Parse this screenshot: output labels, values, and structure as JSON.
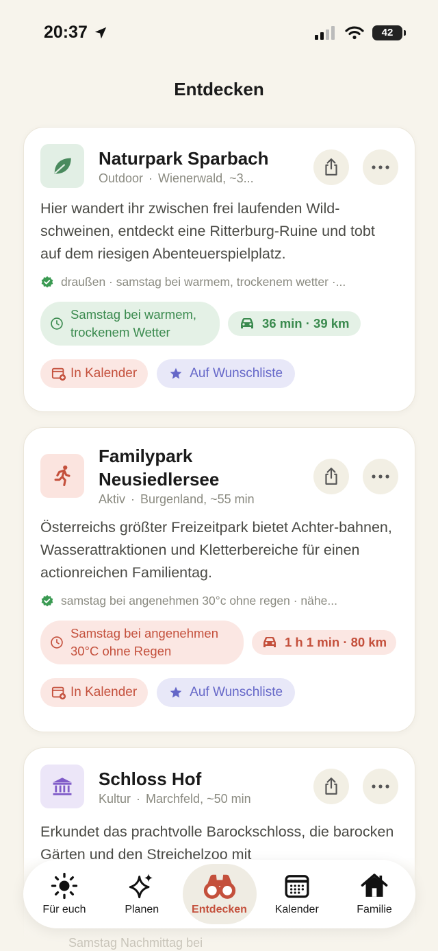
{
  "status": {
    "time": "20:37",
    "battery": "42"
  },
  "page": {
    "title": "Entdecken"
  },
  "cards": [
    {
      "title": "Naturpark Sparbach",
      "category": "Outdoor",
      "location": "Wienerwald, ~3...",
      "description": "Hier wandert ihr zwischen frei laufenden Wild-schweinen, entdeckt eine Ritterburg-Ruine und tobt auf dem riesigen Abenteuerspielplatz.",
      "reason": "draußen · samstag bei warmem, trockenem wetter ·...",
      "time_chip": "Samstag bei warmem, trockenem Wetter",
      "travel": "36 min · 39 km",
      "calendar": "In Kalender",
      "wishlist": "Auf Wunschliste"
    },
    {
      "title": "Familypark Neusiedlersee",
      "category": "Aktiv",
      "location": "Burgenland, ~55 min",
      "description": "Österreichs größter Freizeitpark bietet Achter-bahnen, Wasserattraktionen und Kletterbereiche für einen actionreichen Familientag.",
      "reason": "samstag bei angenehmen 30°c ohne regen · nähe...",
      "time_chip": "Samstag bei angenehmen 30°C ohne Regen",
      "travel": "1 h 1 min · 80 km",
      "calendar": "In Kalender",
      "wishlist": "Auf Wunschliste"
    },
    {
      "title": "Schloss Hof",
      "category": "Kultur",
      "location": "Marchfeld, ~50 min",
      "description": "Erkundet das prachtvolle Barockschloss, die barocken Gärten und den Streichelzoo mit"
    }
  ],
  "below_text": "Samstag Nachmittag bei",
  "nav": {
    "items": [
      {
        "label": "Für euch",
        "icon": "sun-icon"
      },
      {
        "label": "Planen",
        "icon": "sparkles-icon"
      },
      {
        "label": "Entdecken",
        "icon": "binoculars-icon"
      },
      {
        "label": "Kalender",
        "icon": "calendar-icon"
      },
      {
        "label": "Familie",
        "icon": "house-icon"
      }
    ]
  },
  "colors": {
    "accent": "#c4503c",
    "green": "#3a8a4e",
    "purple": "#6567c8"
  }
}
